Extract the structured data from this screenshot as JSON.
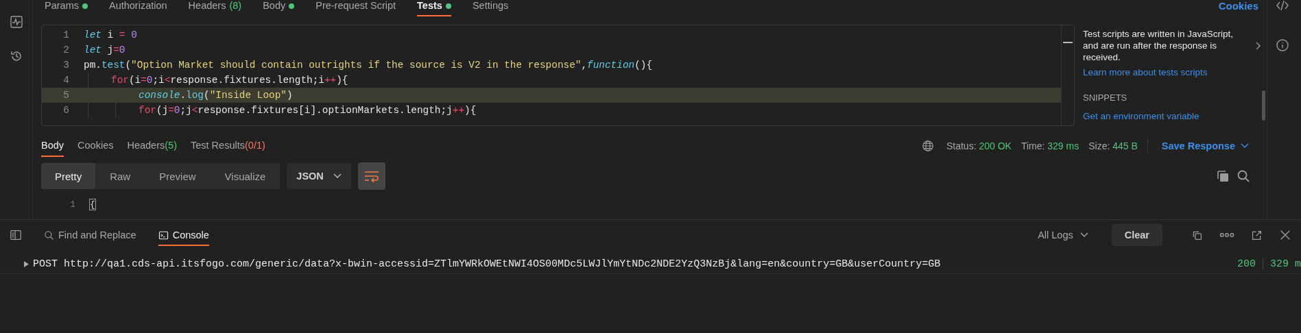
{
  "request_tabs": [
    {
      "label": "Params",
      "dot": true,
      "selected": false
    },
    {
      "label": "Authorization",
      "dot": false,
      "selected": false
    },
    {
      "label": "Headers",
      "count": "(8)",
      "dot": false,
      "selected": false
    },
    {
      "label": "Body",
      "dot": true,
      "selected": false
    },
    {
      "label": "Pre-request Script",
      "dot": false,
      "selected": false
    },
    {
      "label": "Tests",
      "dot": true,
      "selected": true
    },
    {
      "label": "Settings",
      "dot": false,
      "selected": false
    }
  ],
  "cookies_link": "Cookies",
  "editor": {
    "lines": [
      {
        "number": "1",
        "highlighted": false,
        "tokens": [
          {
            "text": "let",
            "kind": "kw"
          },
          {
            "text": " i ",
            "kind": "plain"
          },
          {
            "text": "= ",
            "kind": "op"
          },
          {
            "text": "0",
            "kind": "num"
          }
        ]
      },
      {
        "number": "2",
        "highlighted": false,
        "tokens": [
          {
            "text": "let",
            "kind": "kw"
          },
          {
            "text": " j",
            "kind": "plain"
          },
          {
            "text": "=",
            "kind": "op"
          },
          {
            "text": "0",
            "kind": "num"
          }
        ]
      },
      {
        "number": "3",
        "highlighted": false,
        "tokens": [
          {
            "text": "pm.",
            "kind": "plain"
          },
          {
            "text": "test",
            "kind": "fn"
          },
          {
            "text": "(",
            "kind": "plain"
          },
          {
            "text": "\"Option Market should contain outrights if the source is V2 in the response\"",
            "kind": "str"
          },
          {
            "text": ",",
            "kind": "plain"
          },
          {
            "text": "function",
            "kind": "kw"
          },
          {
            "text": "(){",
            "kind": "plain"
          }
        ],
        "children": [
          {
            "number": "4",
            "highlighted": false,
            "tokens": [
              {
                "text": "for",
                "kind": "op"
              },
              {
                "text": "(i",
                "kind": "plain"
              },
              {
                "text": "=",
                "kind": "op"
              },
              {
                "text": "0",
                "kind": "num"
              },
              {
                "text": ";i",
                "kind": "plain"
              },
              {
                "text": "<",
                "kind": "op"
              },
              {
                "text": "response.fixtures.length;i",
                "kind": "plain"
              },
              {
                "text": "++",
                "kind": "op"
              },
              {
                "text": "){",
                "kind": "plain"
              }
            ],
            "children": [
              {
                "number": "5",
                "highlighted": true,
                "tokens": [
                  {
                    "text": "console",
                    "kind": "kw"
                  },
                  {
                    "text": ".",
                    "kind": "plain"
                  },
                  {
                    "text": "log",
                    "kind": "fn"
                  },
                  {
                    "text": "(",
                    "kind": "plain"
                  },
                  {
                    "text": "\"Inside Loop\"",
                    "kind": "str"
                  },
                  {
                    "text": ")",
                    "kind": "plain"
                  }
                ]
              },
              {
                "number": "6",
                "highlighted": false,
                "tokens": [
                  {
                    "text": "for",
                    "kind": "op"
                  },
                  {
                    "text": "(j",
                    "kind": "plain"
                  },
                  {
                    "text": "=",
                    "kind": "op"
                  },
                  {
                    "text": "0",
                    "kind": "num"
                  },
                  {
                    "text": ";j",
                    "kind": "plain"
                  },
                  {
                    "text": "<",
                    "kind": "op"
                  },
                  {
                    "text": "response.fixtures[i].optionMarkets.length;j",
                    "kind": "plain"
                  },
                  {
                    "text": "++",
                    "kind": "op"
                  },
                  {
                    "text": "){",
                    "kind": "plain"
                  }
                ]
              }
            ]
          }
        ]
      }
    ]
  },
  "side_panel": {
    "description": "Test scripts are written in JavaScript, and are run after the response is received.",
    "learn_link": "Learn more about tests scripts",
    "snippets_heading": "SNIPPETS",
    "snippets": [
      "Get an environment variable"
    ]
  },
  "response_tabs": [
    {
      "label": "Body",
      "selected": true
    },
    {
      "label": "Cookies",
      "selected": false
    },
    {
      "label": "Headers",
      "count": "(5)",
      "color": "#4fc67c",
      "selected": false
    },
    {
      "label": "Test Results",
      "count": "(0/1)",
      "color": "#f07866",
      "selected": false
    }
  ],
  "status": [
    {
      "label": "Status:",
      "value": "200 OK"
    },
    {
      "label": "Time:",
      "value": "329 ms"
    },
    {
      "label": "Size:",
      "value": "445 B"
    }
  ],
  "save_response": "Save Response",
  "view_modes": [
    {
      "label": "Pretty",
      "selected": true
    },
    {
      "label": "Raw",
      "selected": false
    },
    {
      "label": "Preview",
      "selected": false
    },
    {
      "label": "Visualize",
      "selected": false
    }
  ],
  "format": "JSON",
  "wrap_on": true,
  "body_lines": [
    {
      "number": "1",
      "text": "{"
    }
  ],
  "console_tabs": [
    {
      "label": "Find and Replace",
      "kind": "search",
      "selected": false
    },
    {
      "label": "Console",
      "kind": "terminal",
      "selected": true
    }
  ],
  "log_filter": "All Logs",
  "clear_button": "Clear",
  "log_entries": [
    {
      "method": "POST",
      "url": "http://qa1.cds-api.itsfogo.com/generic/data?x-bwin-accessid=ZTlmYWRkOWEtNWI4OS00MDc5LWJlYmYtNDc2NDE2YzQ3NzBj&lang=en&country=GB&userCountry=GB",
      "status": "200",
      "time": "329 m"
    }
  ]
}
